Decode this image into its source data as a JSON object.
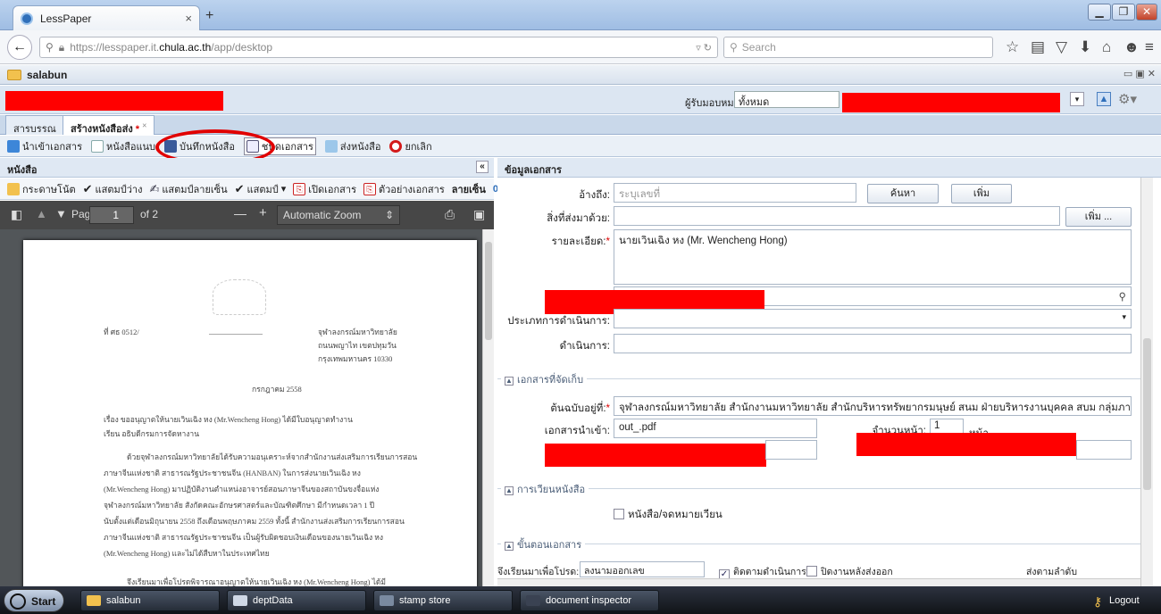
{
  "browser": {
    "tab_title": "LessPaper",
    "tab_close": "×",
    "new_tab": "+",
    "url_prefix": "https://lesspaper.it.",
    "url_host": "chula.ac.th",
    "url_path": "/app/desktop",
    "search_placeholder": "Search"
  },
  "app": {
    "window_title": "salabun",
    "recipient_label": "ผู้รับมอบหมาย:",
    "recipient_value": "ทั้งหมด"
  },
  "tabs": [
    {
      "label": "สารบรรณ"
    },
    {
      "label": "สร้างหนังสือส่ง",
      "marker": "*",
      "close": "×"
    }
  ],
  "toolbar": {
    "import": "นำเข้าเอกสาร",
    "attach": "หนังสือแนบ",
    "save": "บันทึกหนังสือ",
    "type": "ชนิดเอกสาร",
    "send": "ส่งหนังสือ",
    "cancel": "ยกเลิก"
  },
  "left_panel": {
    "title": "หนังสือ",
    "collapse": "«",
    "stamps": [
      "กระดาษโน้ต",
      "แสตมป์ว่าง",
      "แสตมป์ลายเซ็น",
      "แสตมป์",
      "เปิดเอกสาร",
      "ตัวอย่างเอกสาร"
    ],
    "stamp_dropdown": "▾",
    "signature_label": "ลายเซ็น",
    "signature_count": "0",
    "pdf": {
      "page_label": "Page:",
      "page_current": "1",
      "page_total": "of 2",
      "zoom": "Automatic Zoom",
      "minus": "—",
      "plus": "+"
    },
    "doc_text": {
      "ref_no": "ที่ ศธ 0512/",
      "org_line1": "จุฬาลงกรณ์มหาวิทยาลัย",
      "org_line2": "ถนนพญาไท เขตปทุมวัน",
      "org_line3": "กรุงเทพมหานคร 10330",
      "date": "กรกฎาคม 2558",
      "subject": "เรื่อง   ขออนุญาตให้นายเวินเฉิง หง (Mr.Wencheng Hong) ได้มีใบอนุญาตทำงาน",
      "to": "เรียน   อธิบดีกรมการจัดหางาน",
      "body1": "ด้วยจุฬาลงกรณ์มหาวิทยาลัยได้รับความอนุเคราะห์จากสำนักงานส่งเสริมการเรียนการสอน",
      "body2": "ภาษาจีนแห่งชาติ สาธารณรัฐประชาชนจีน (HANBAN)     ในการส่งนายเวินเฉิง หง",
      "body3": "(Mr.Wencheng    Hong) มาปฏิบัติงานตำแหน่งอาจารย์สอนภาษาจีนของสถาบันขงจื่อแห่ง",
      "body4": "จุฬาลงกรณ์มหาวิทยาลัย สังกัดคณะอักษรศาสตร์และบัณฑิตศึกษา มีกำหนดเวลา 1 ปี",
      "body5": "นับตั้งแต่เดือนมิถุนายน 2558 ถึงเดือนพฤษภาคม 2559 ทั้งนี้ สำนักงานส่งเสริมการเรียนการสอน",
      "body6": "ภาษาจีนแห่งชาติ สาธารณรัฐประชาชนจีน เป็นผู้รับผิดชอบเงินเดือนของนายเวินเฉิง หง",
      "body7": "(Mr.Wencheng Hong) และไม่ได้สืบหาในประเทศไทย",
      "body8": "จึงเรียนมาเพื่อโปรดพิจารณาอนุญาตให้นายเวินเฉิง หง  (Mr.Wencheng    Hong) ได้มี"
    }
  },
  "right_panel": {
    "title": "ข้อมูลเอกสาร",
    "ref_label": "อ้างถึง:",
    "ref_placeholder": "ระบุเลขที่",
    "search_btn": "ค้นหา",
    "add_btn": "เพิ่ม",
    "enclosure_label": "สิ่งที่ส่งมาด้วย:",
    "add_more_btn": "เพิ่ม ...",
    "detail_label": "รายละเอียด:",
    "detail_value": "นายเวินเฉิง หง (Mr. Wencheng Hong)",
    "action_type_label": "ประเภทการดำเนินการ:",
    "action_label": "ดำเนินการ:",
    "storage_section": "เอกสารที่จัดเก็บ",
    "original_label": "ต้นฉบับอยู่ที่:",
    "original_value": "จุฬาลงกรณ์มหาวิทยาลัย สำนักงานมหาวิทยาลัย สำนักบริหารทรัพยากรมนุษย์ สนม ฝ่ายบริหารงานบุคคล สบม กลุ่มภารกิจข้าราชการ",
    "import_label": "เอกสารนำเข้า:",
    "import_value": "out_.pdf",
    "pages_label": "จำนวนหน้า:",
    "pages_value": "1",
    "pages_unit": "หน้า",
    "circulation_section": "การเวียนหนังสือ",
    "circulation_check": "หนังสือ/จดหมายเวียน",
    "steps_section": "ขั้นตอนเอกสาร",
    "step_notify": "จึงเรียนมาเพื่อโปรด:",
    "step_notify_value": "ลงนามออกเลข",
    "step_follow": "ติดตามดำเนินการ",
    "step_close": "ปิดงานหลังส่งออก",
    "step_order": "ส่งตามลำดับ"
  },
  "taskbar": {
    "start": "Start",
    "items": [
      "salabun",
      "deptData",
      "stamp store",
      "document inspector"
    ],
    "logout": "Logout"
  },
  "colors": {
    "accent": "#2f6fba",
    "redaction": "#ff0000",
    "annotation_circle": "#e10000"
  }
}
